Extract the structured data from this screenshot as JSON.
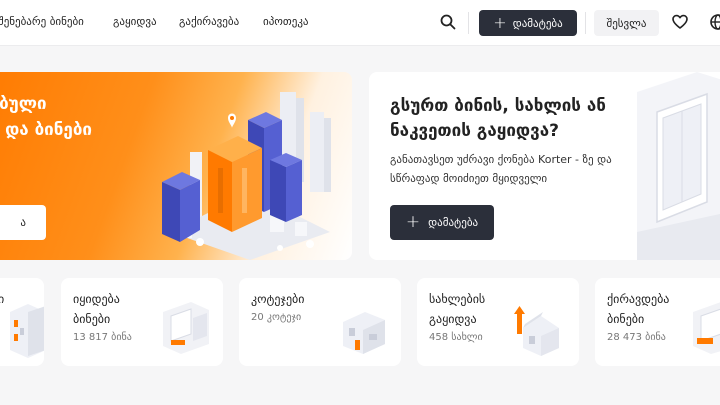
{
  "header": {
    "nav": [
      "შენებარე ბინები",
      "გაყიდვა",
      "გაქირავება",
      "იპოთეკა"
    ],
    "add_label": "დამატება",
    "login_label": "შესვლა",
    "icons": [
      "search-icon",
      "heart-icon",
      "globe-icon"
    ]
  },
  "hero": {
    "title": "ნებული\nბი და ბინები\n)",
    "button_label": "ა"
  },
  "sell_card": {
    "title": "გსურთ ბინის, სახლის ან ნაკვეთის გაყიდვა?",
    "subtitle": "განათავსეთ უძრავი ქონება Korter - ზე და სწრაფად მოიძიეთ მყიდველი",
    "button_label": "დამატება"
  },
  "categories": [
    {
      "title": "ი",
      "count": ""
    },
    {
      "title": "იყიდება\nბინები",
      "count": "13 817 ბინა"
    },
    {
      "title": "კოტეჯები",
      "count": "20 კოტეჯი"
    },
    {
      "title": "სახლების\nგაყიდვა",
      "count": "458 სახლი"
    },
    {
      "title": "ქირავდება\nბინები",
      "count": "28 473 ბინა"
    }
  ],
  "colors": {
    "accent": "#ff7a00",
    "dark_button": "#2b2f3a",
    "building_blue": "#4a55c8"
  }
}
